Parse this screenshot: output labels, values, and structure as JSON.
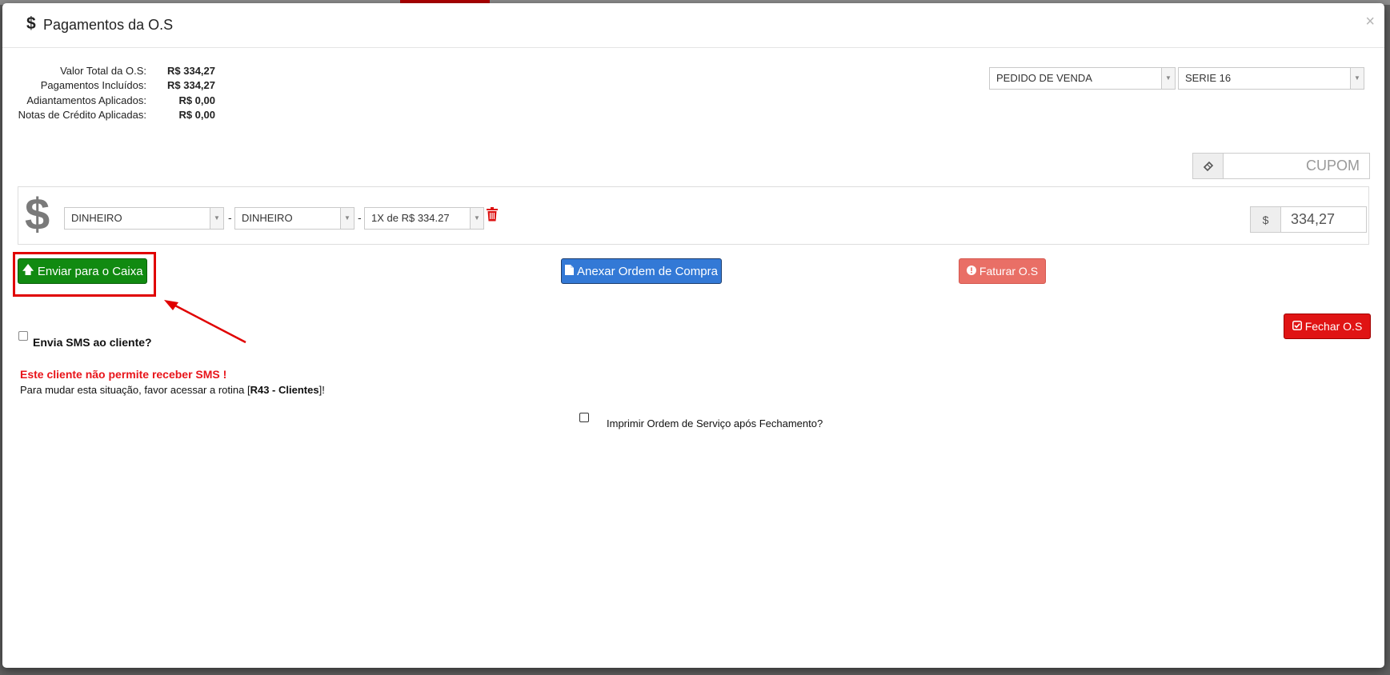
{
  "header": {
    "icon": "dollar-sign-icon",
    "title": "Pagamentos da O.S",
    "close_label": "×"
  },
  "summary": [
    {
      "label": "Valor Total da O.S:",
      "value": "R$ 334,27"
    },
    {
      "label": "Pagamentos Incluídos:",
      "value": "R$ 334,27"
    },
    {
      "label": "Adiantamentos Aplicados:",
      "value": "R$ 0,00"
    },
    {
      "label": "Notas de Crédito Aplicadas:",
      "value": "R$ 0,00"
    }
  ],
  "document_type": {
    "selected": "PEDIDO DE VENDA"
  },
  "series": {
    "selected": "SERIE 16"
  },
  "coupon": {
    "icon": "ticket-icon",
    "placeholder": "CUPOM"
  },
  "payment": {
    "icon": "dollar-sign-icon",
    "method": "DINHEIRO",
    "submethod": "DINHEIRO",
    "installments": "1X de R$ 334.27",
    "separator": "-",
    "currency_addon": "$",
    "amount": "334,27"
  },
  "actions": {
    "send_to_cashier": "Enviar para o Caixa",
    "attach_purchase_order": "Anexar Ordem de Compra",
    "invoice": "Faturar O.S",
    "close_os": "Fechar O.S"
  },
  "sms": {
    "checkbox_label": "Envia SMS ao cliente?",
    "warning": "Este cliente não permite receber SMS !",
    "info_prefix": "Para mudar esta situação, favor acessar a rotina [",
    "info_link": "R43 - Clientes",
    "info_suffix": "]!"
  },
  "print_checkbox_label": "Imprimir Ordem de Serviço após Fechamento?",
  "colors": {
    "send_button": "#118a11",
    "attach_button": "#3379d6",
    "invoice_button": "#e96f66",
    "close_button": "#e01414",
    "annotation": "#e00000"
  }
}
